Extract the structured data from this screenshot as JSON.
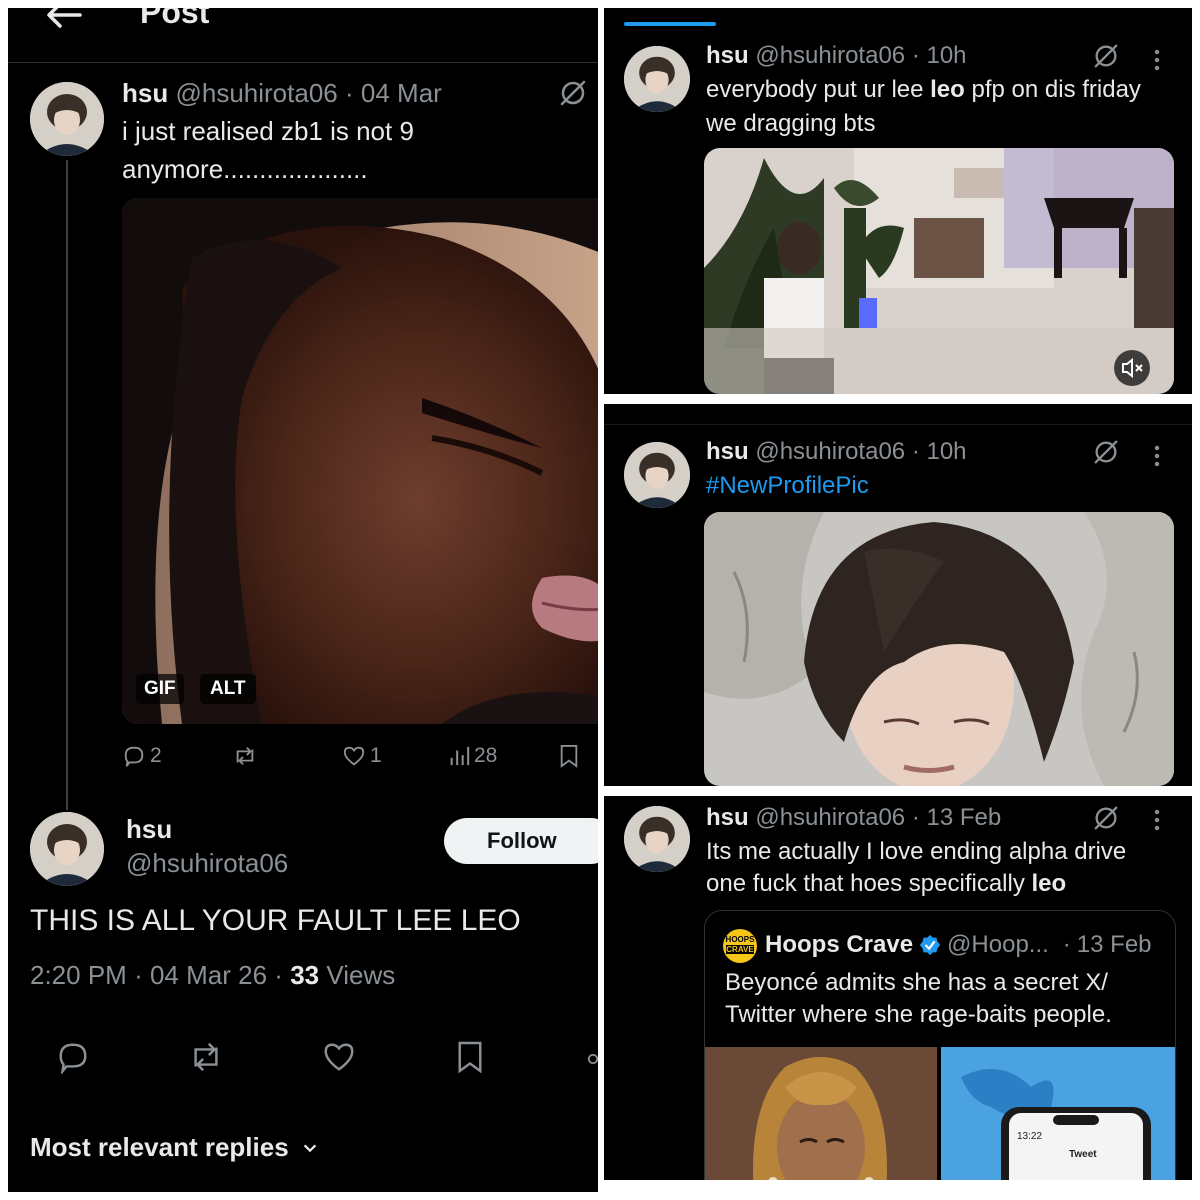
{
  "panel1": {
    "header_title": "Post",
    "post": {
      "display_name": "hsu",
      "handle": "@hsuhirota06",
      "sep": "·",
      "date": "04 Mar",
      "text_line1": "i just realised zb1 is not 9",
      "text_line2": "anymore....................",
      "badge_gif": "GIF",
      "badge_alt": "ALT",
      "replies": "2",
      "likes": "1",
      "views": "28"
    },
    "main": {
      "display_name": "hsu",
      "handle": "@hsuhirota06",
      "follow_label": "Follow",
      "text": "THIS IS ALL YOUR FAULT LEE LEO",
      "time": "2:20 PM",
      "sep1": "·",
      "date": "04 Mar 26",
      "sep2": "·",
      "views_count": "33",
      "views_label": "Views",
      "replies_sort": "Most relevant replies"
    }
  },
  "panel2": {
    "display_name": "hsu",
    "handle": "@hsuhirota06",
    "sep": "·",
    "time": "10h",
    "text_part1": "everybody put ur lee ",
    "text_bold": "leo",
    "text_part2": " pfp on dis friday",
    "text_line2": "we dragging bts"
  },
  "panel3": {
    "display_name": "hsu",
    "handle": "@hsuhirota06",
    "sep": "·",
    "time": "10h",
    "hashtag": "#NewProfilePic"
  },
  "panel4": {
    "display_name": "hsu",
    "handle": "@hsuhirota06",
    "sep": "·",
    "time": "13 Feb",
    "text_line1": "Its me actually I love ending alpha drive",
    "text_line2_part1": "one fuck that hoes specifically ",
    "text_line2_bold": "leo",
    "quote": {
      "logo_line1": "HOOPS",
      "logo_line2": "CRAVE",
      "display_name": "Hoops Crave",
      "handle": "@Hoop...",
      "sep": "·",
      "time": "13 Feb",
      "text_line1": "Beyoncé admits she has a secret X/",
      "text_line2": "Twitter where she rage-baits people.",
      "phone_time": "13:22",
      "phone_title": "Tweet"
    }
  },
  "colors": {
    "background": "#000000",
    "text": "#e7e9ea",
    "muted": "#8b9095",
    "accent": "#1d9bf0",
    "verified": "#1d9bf0"
  },
  "icons": [
    "back-arrow-icon",
    "grok-icon",
    "more-icon",
    "reply-icon",
    "repost-icon",
    "like-icon",
    "views-icon",
    "bookmark-icon",
    "share-icon",
    "mute-icon",
    "verified-icon",
    "chevron-down-icon"
  ]
}
